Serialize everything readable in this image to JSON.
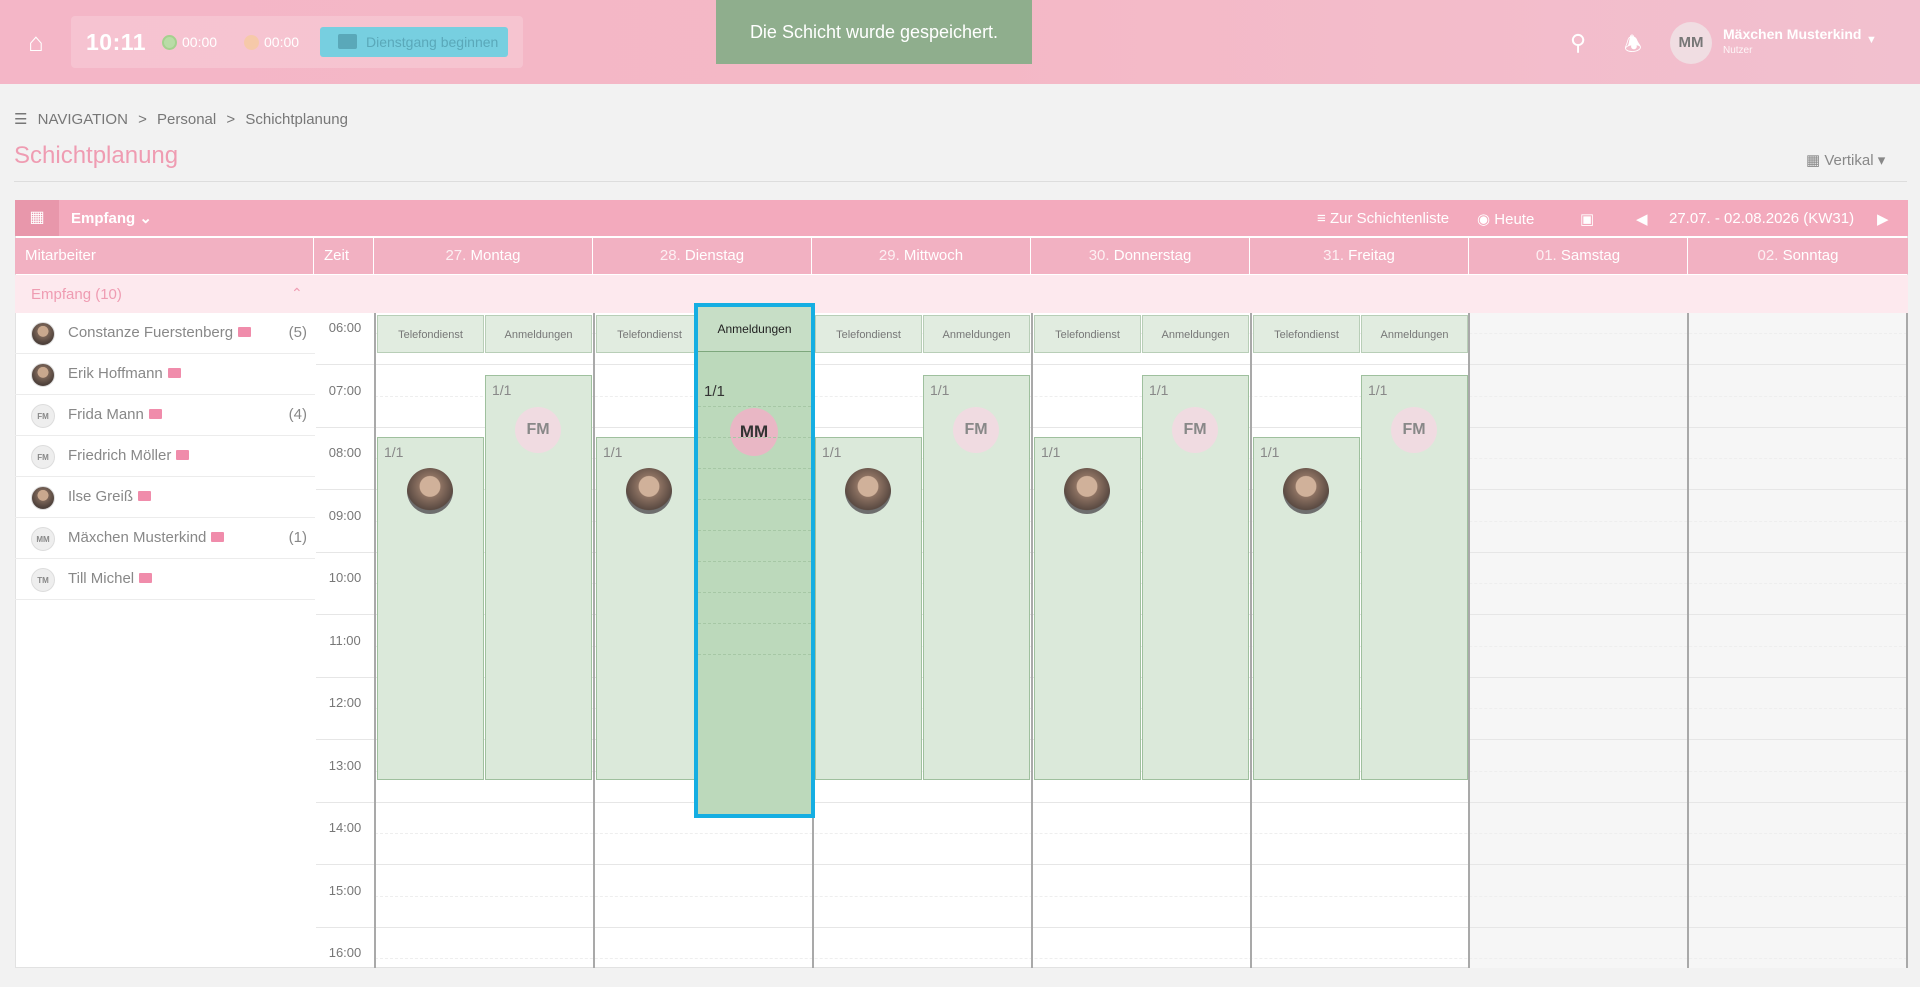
{
  "topbar": {
    "clock": "10:11",
    "counter1": "00:00",
    "counter2": "00:00",
    "dienstgang_label": "Dienstgang beginnen",
    "toast": "Die Schicht wurde gespeichert.",
    "user_initials": "MM",
    "user_name": "Mäxchen Musterkind",
    "user_role": "Nutzer"
  },
  "breadcrumb": [
    "NAVIGATION",
    ">",
    "Personal",
    ">",
    "Schichtplanung"
  ],
  "page_title": "Schichtplanung",
  "view_select": "Vertikal",
  "toolbar": {
    "group": "Empfang",
    "to_list": "Zur Schichtenliste",
    "today": "Heute",
    "range": "27.07. - 02.08.2026  (KW31)"
  },
  "header": {
    "employees": "Mitarbeiter",
    "time": "Zeit",
    "days": [
      {
        "num": "27.",
        "name": "Montag"
      },
      {
        "num": "28.",
        "name": "Dienstag"
      },
      {
        "num": "29.",
        "name": "Mittwoch"
      },
      {
        "num": "30.",
        "name": "Donnerstag"
      },
      {
        "num": "31.",
        "name": "Freitag"
      },
      {
        "num": "01.",
        "name": "Samstag"
      },
      {
        "num": "02.",
        "name": "Sonntag"
      }
    ]
  },
  "group_row": "Empfang (10)",
  "employees": [
    {
      "name": "Constanze Fuerstenberg",
      "count": "(5)",
      "avatar": "photo"
    },
    {
      "name": "Erik Hoffmann",
      "count": "",
      "avatar": "photo"
    },
    {
      "name": "Frida Mann",
      "count": "(4)",
      "avatar": "FM"
    },
    {
      "name": "Friedrich Möller",
      "count": "",
      "avatar": "FM"
    },
    {
      "name": "Ilse Greiß",
      "count": "",
      "avatar": "photo"
    },
    {
      "name": "Mäxchen Musterkind",
      "count": "(1)",
      "avatar": "MM"
    },
    {
      "name": "Till Michel",
      "count": "",
      "avatar": "TM"
    }
  ],
  "times": [
    "06:00",
    "07:00",
    "08:00",
    "09:00",
    "10:00",
    "11:00",
    "12:00",
    "13:00",
    "14:00",
    "15:00",
    "16:00"
  ],
  "shift_names": {
    "a": "Telefondienst",
    "b": "Anmeldungen"
  },
  "fraction": "1/1",
  "fm_initials": "FM",
  "highlight": {
    "shift": "Anmeldungen",
    "fraction": "1/1",
    "initials": "MM"
  }
}
